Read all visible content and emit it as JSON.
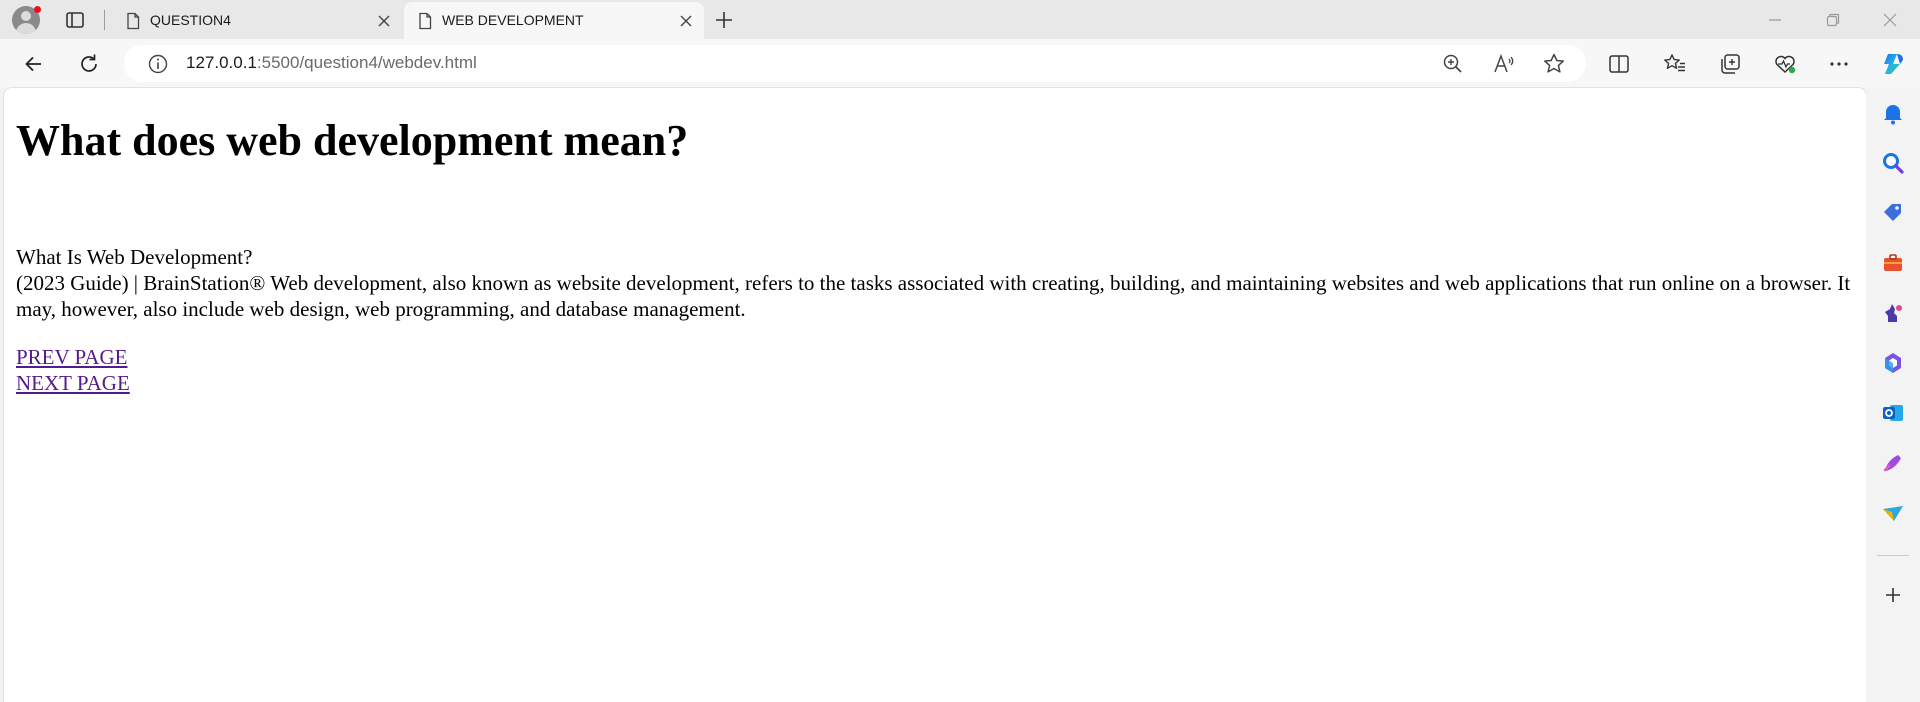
{
  "browser": {
    "tabs": [
      {
        "title": "QUESTION4",
        "active": false
      },
      {
        "title": "WEB DEVELOPMENT",
        "active": true
      }
    ],
    "address": {
      "host": "127.0.0.1",
      "path": ":5500/question4/webdev.html"
    },
    "colors": {
      "profile_badge": "#e81123",
      "copilot": "#1a73e8",
      "link_visited": "#551a8b"
    },
    "toolbar_icons": [
      "back-icon",
      "refresh-icon",
      "site-info-icon",
      "zoom-icon",
      "read-aloud-icon",
      "favorite-star-icon",
      "split-screen-icon",
      "favorites-icon",
      "collections-icon",
      "browser-essentials-icon",
      "more-icon",
      "copilot-icon"
    ],
    "sidebar_icons": [
      "notifications-icon",
      "search-icon",
      "shopping-icon",
      "tools-icon",
      "games-icon",
      "microsoft-365-icon",
      "outlook-icon",
      "designer-icon",
      "send-icon",
      "add-icon"
    ]
  },
  "page": {
    "heading": "What does web development mean?",
    "question": "What Is Web Development?",
    "paragraph": "(2023 Guide) | BrainStation® Web development, also known as website development, refers to the tasks associated with creating, building, and maintaining websites and web applications that run online on a browser. It may, however, also include web design, web programming, and database management.",
    "links": {
      "prev": "PREV PAGE",
      "next": "NEXT PAGE"
    }
  }
}
